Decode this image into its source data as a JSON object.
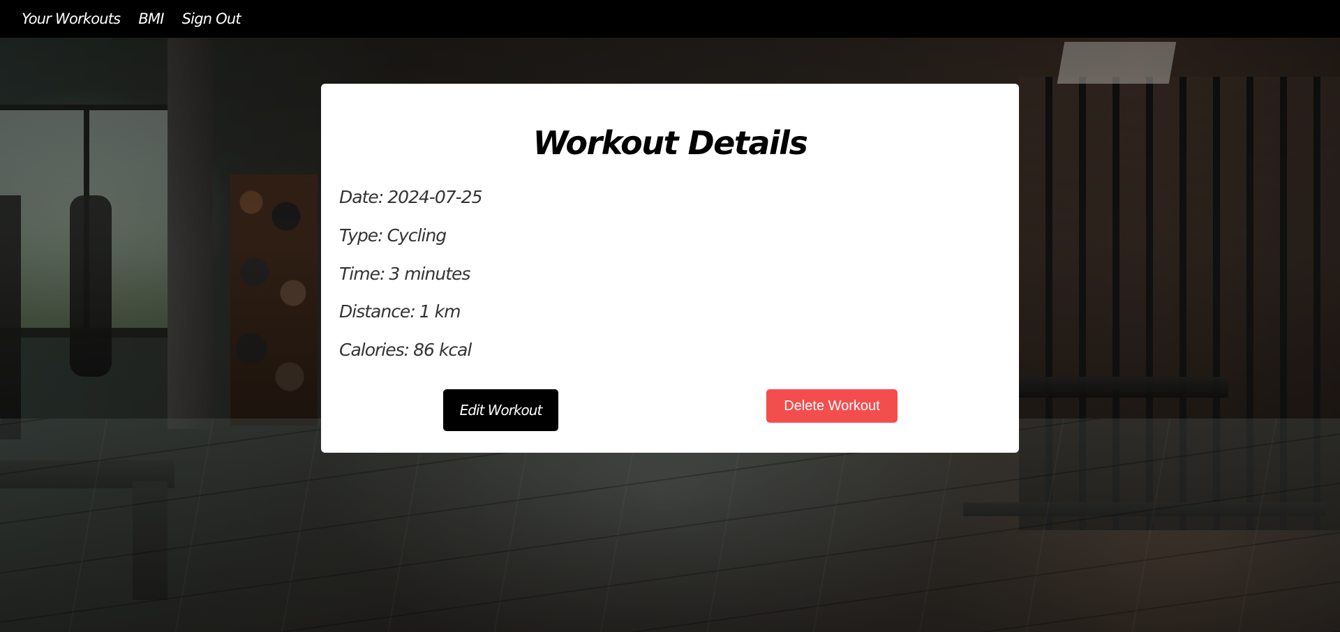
{
  "nav": {
    "items": [
      {
        "label": "Your Workouts"
      },
      {
        "label": "BMI"
      },
      {
        "label": "Sign Out"
      }
    ]
  },
  "card": {
    "title": "Workout Details",
    "details": [
      {
        "label": "Date:",
        "value": "2024-07-25"
      },
      {
        "label": "Type:",
        "value": "Cycling"
      },
      {
        "label": "Time:",
        "value": "3 minutes"
      },
      {
        "label": "Distance:",
        "value": "1 km"
      },
      {
        "label": "Calories:",
        "value": "86 kcal"
      }
    ],
    "edit_label": "Edit Workout",
    "delete_label": "Delete Workout"
  },
  "colors": {
    "navbar": "#000000",
    "card": "#ffffff",
    "edit_button": "#000000",
    "delete_button": "#f44d4d"
  }
}
